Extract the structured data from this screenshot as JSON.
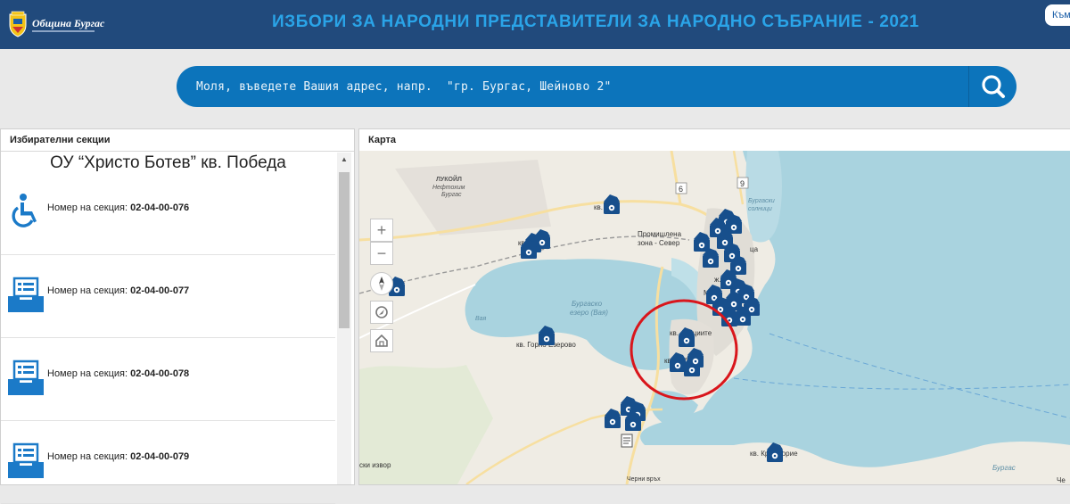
{
  "header": {
    "logo_text": "Община Бургас",
    "title": "ИЗБОРИ ЗА НАРОДНИ ПРЕДСТАВИТЕЛИ ЗА НАРОДНО СЪБРАНИЕ - 2021",
    "lang_button": "Към"
  },
  "search": {
    "placeholder": "Моля, въведете Вашия адрес, напр.  \"гр. Бургас, Шейново 2\""
  },
  "left_panel": {
    "title": "Избирателни секции",
    "school": "ОУ “Христо Ботев” кв. Победа",
    "sections": [
      {
        "prefix": "Номер на секция:",
        "number": "02-04-00-076",
        "icon": "wheelchair-icon"
      },
      {
        "prefix": "Номер на секция:",
        "number": "02-04-00-077",
        "icon": "ballot-box-icon"
      },
      {
        "prefix": "Номер на секция:",
        "number": "02-04-00-078",
        "icon": "ballot-box-icon"
      },
      {
        "prefix": "Номер на секция:",
        "number": "02-04-00-079",
        "icon": "ballot-box-icon"
      }
    ]
  },
  "map_panel": {
    "title": "Карта",
    "labels": {
      "lukoil": "ЛУКОЙЛ",
      "neftochim": "Нефтохим",
      "burgas_small": "Бургас",
      "kv_1": "кв.",
      "kv_2": "кв.",
      "kv_vetren": "кв.",
      "promishlena": "Промишлена",
      "zona_sever": "зона - Север",
      "zh_k": "ж.к.",
      "burgasko_ezero_1": "Бургаско",
      "burgasko_ezero_2": "езеро (Вая)",
      "vaya": "Вая",
      "kv_gorno_ezerovo": "кв. Горно Езерово",
      "kv_akatsiite": "кв. Акациите",
      "kv_pobeda": "кв. Победа",
      "burgaski_solnitsi_1": "Бургаски",
      "burgaski_solnitsi_2": "солници",
      "kv_kraimorie": "кв. Крайморие",
      "cherni_vrah": "Черни връх",
      "iski_izvor": "ски извор",
      "burgas_sea": "Бургас",
      "road_6": "6",
      "road_9": "9",
      "partial_m": "М",
      "partial_tsa": "ца",
      "partial_che": "Че"
    }
  },
  "colors": {
    "header_bg": "#214a7c",
    "title": "#2aa4e8",
    "search_bg": "#0c74bb",
    "marker": "#174f8c",
    "water": "#a9d3df",
    "highlight_circle": "#d9161c"
  }
}
